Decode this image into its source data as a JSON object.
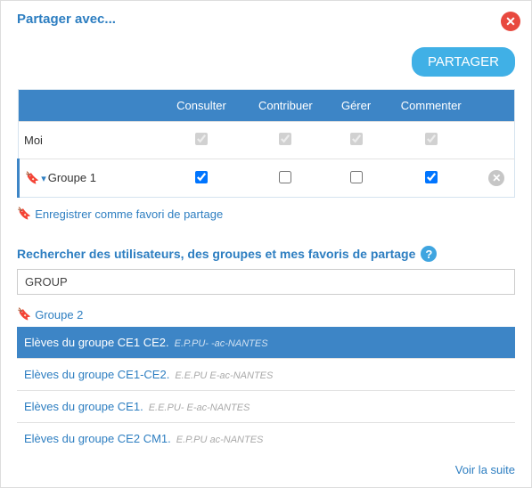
{
  "title": "Partager avec...",
  "share_button": "PARTAGER",
  "columns": {
    "consult": "Consulter",
    "contribute": "Contribuer",
    "manage": "Gérer",
    "comment": "Commenter"
  },
  "rows": {
    "me": {
      "label": "Moi"
    },
    "group1": {
      "label": "Groupe 1"
    }
  },
  "save_favorite": "Enregistrer comme favori de partage",
  "search_label": "Rechercher des utilisateurs, des groupes et mes favoris de partage",
  "search_value": "GROUP",
  "favorite_group": "Groupe 2",
  "results": [
    {
      "name": "Elèves du groupe CE1 CE2.",
      "detail": "E.P.PU-                        -ac-NANTES",
      "selected": true
    },
    {
      "name": "Elèves du groupe CE1-CE2.",
      "detail": "E.E.PU                                     E-ac-NANTES",
      "selected": false
    },
    {
      "name": "Elèves du groupe CE1.",
      "detail": "E.E.PU-                                E-ac-NANTES",
      "selected": false
    },
    {
      "name": "Elèves du groupe CE2 CM1.",
      "detail": "E.P.PU                            ac-NANTES",
      "selected": false
    }
  ],
  "see_more": "Voir la suite"
}
